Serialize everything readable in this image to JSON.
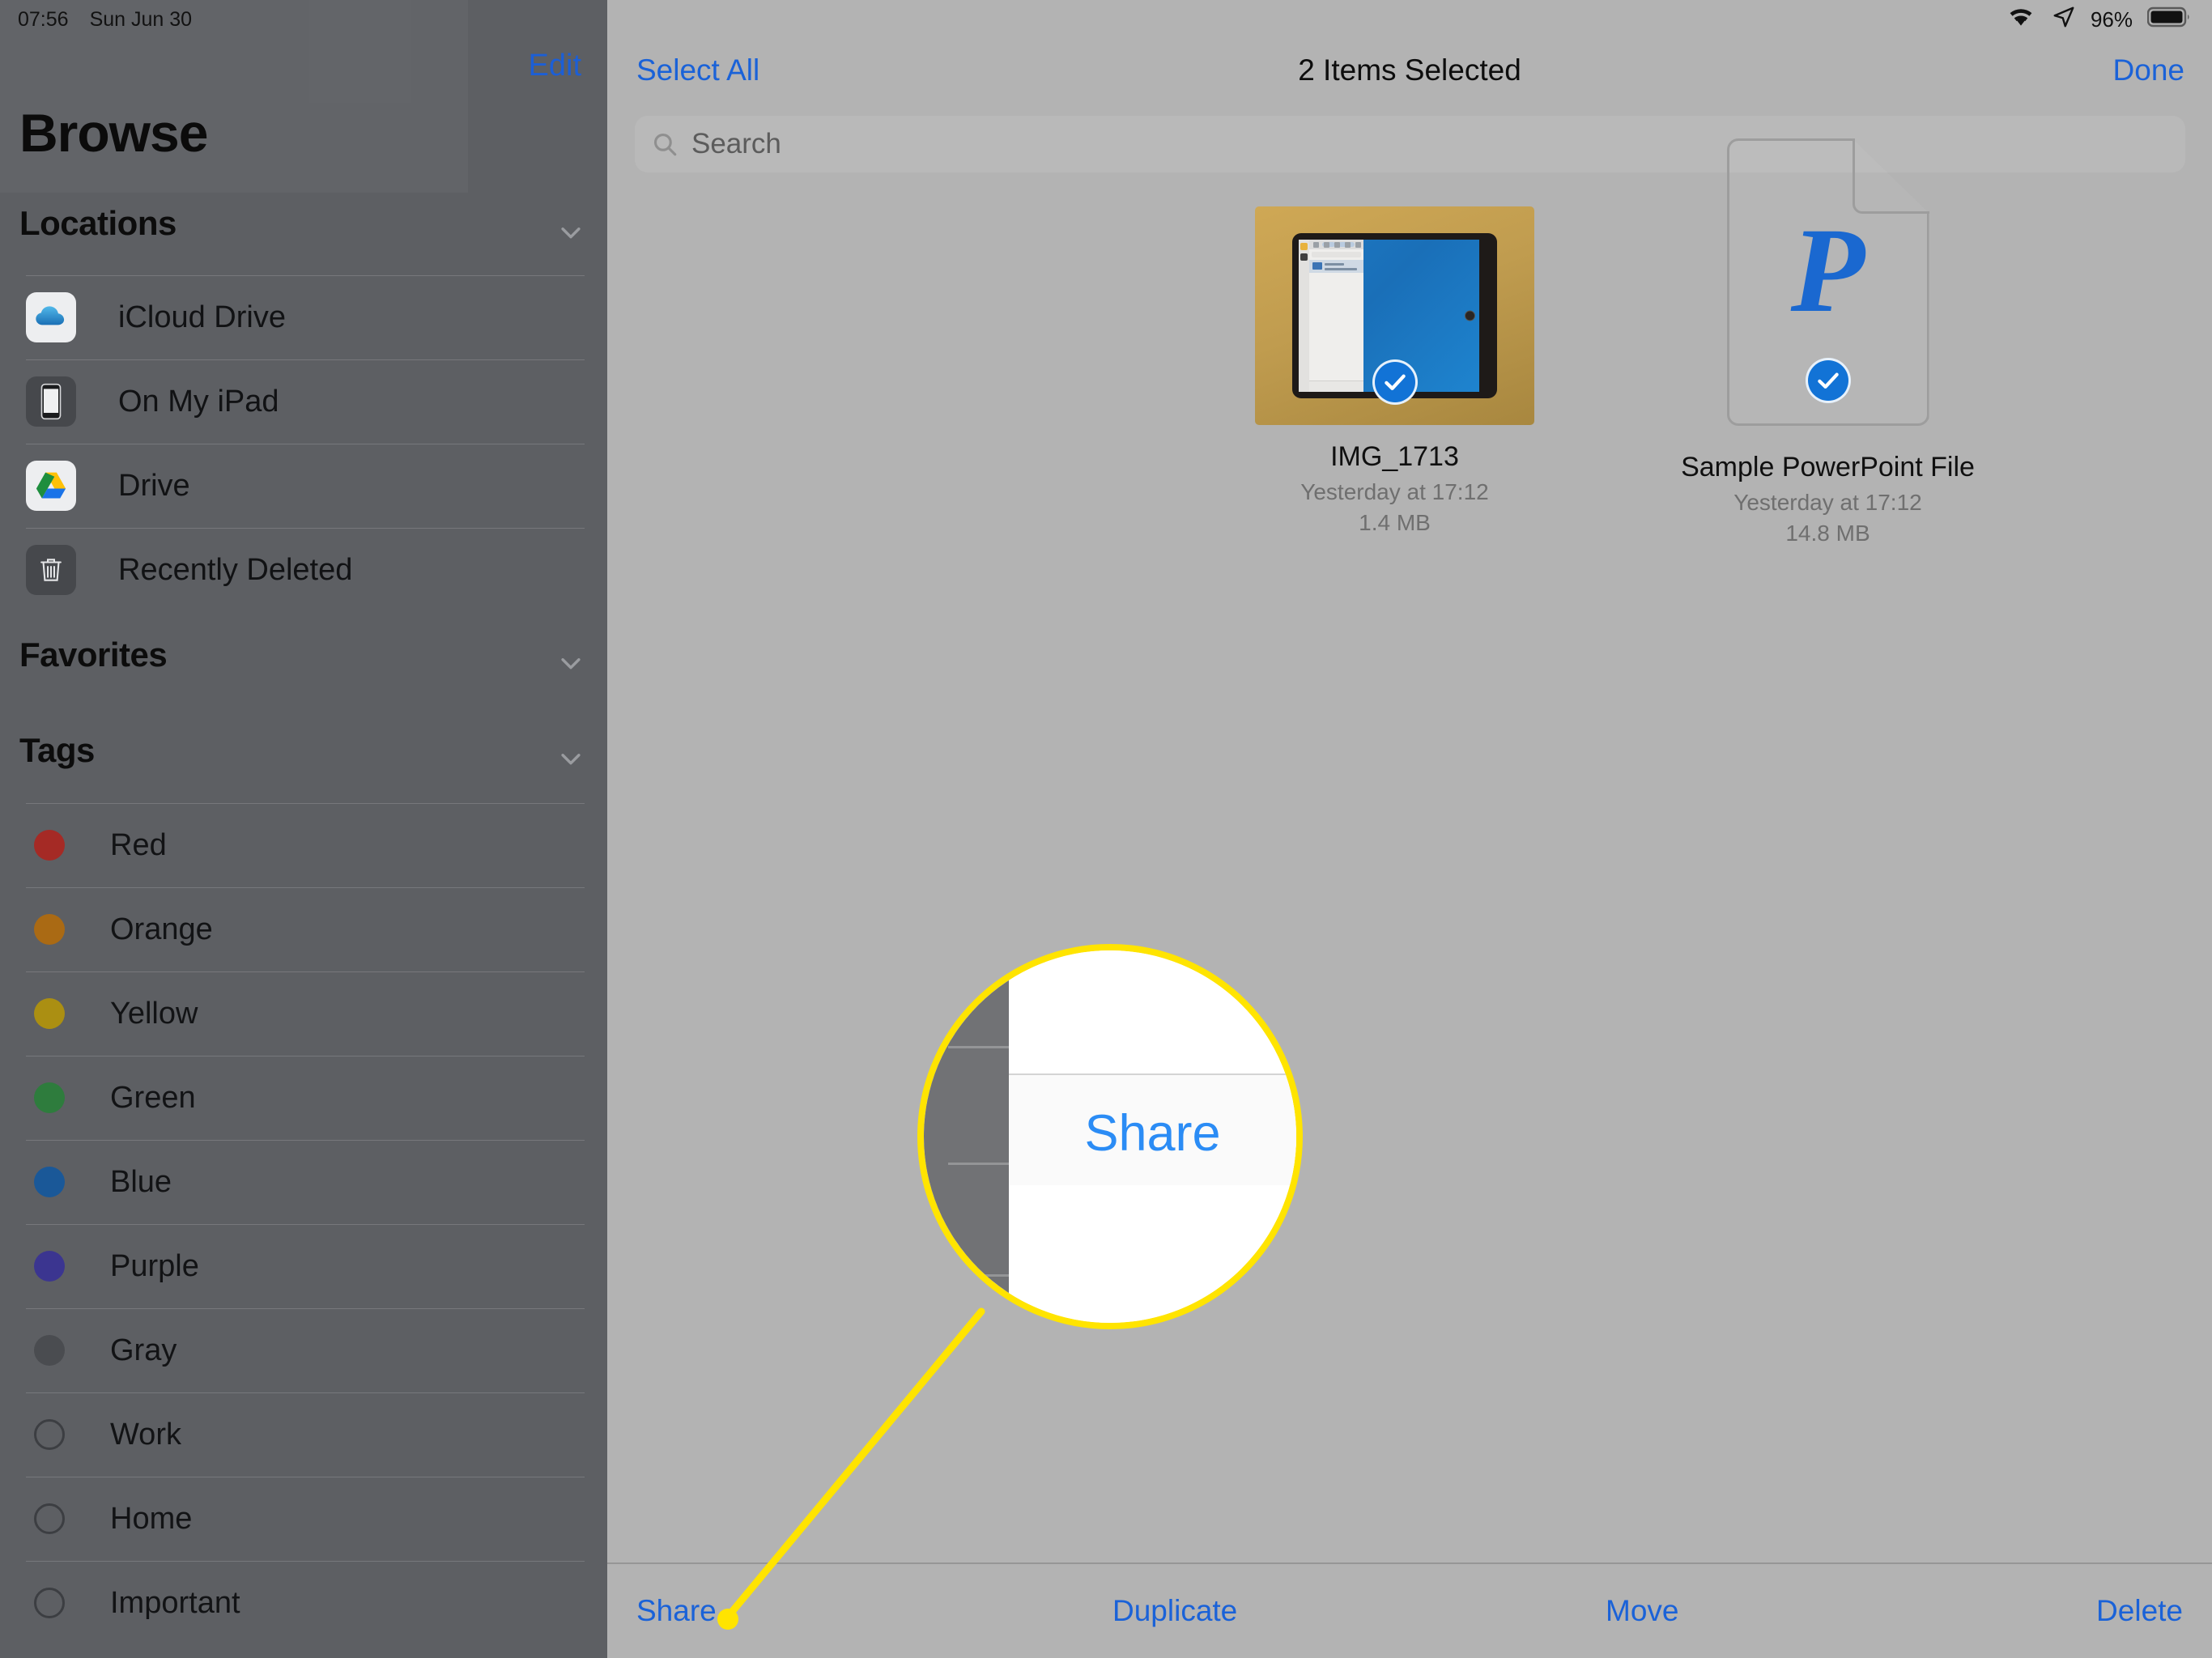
{
  "status_bar": {
    "time": "07:56",
    "date": "Sun Jun 30",
    "wifi_icon": "wifi-icon",
    "location_icon": "location-arrow-icon",
    "battery_percent": "96%",
    "battery_icon": "battery-icon"
  },
  "sidebar": {
    "edit_label": "Edit",
    "title": "Browse",
    "sections": [
      {
        "header": "Locations",
        "chevron_icon": "chevron-down-icon"
      },
      {
        "header": "Favorites",
        "chevron_icon": "chevron-down-icon"
      },
      {
        "header": "Tags",
        "chevron_icon": "chevron-down-icon"
      }
    ],
    "locations": [
      {
        "label": "iCloud Drive",
        "icon": "icloud-drive-icon"
      },
      {
        "label": "On My iPad",
        "icon": "ipad-device-icon"
      },
      {
        "label": "Drive",
        "icon": "google-drive-icon"
      },
      {
        "label": "Recently Deleted",
        "icon": "trash-icon"
      }
    ],
    "tags": [
      {
        "label": "Red",
        "color": "#a52a25",
        "filled": true
      },
      {
        "label": "Orange",
        "color": "#aa6a14",
        "filled": true
      },
      {
        "label": "Yellow",
        "color": "#ab8f12",
        "filled": true
      },
      {
        "label": "Green",
        "color": "#2e7c3d",
        "filled": true
      },
      {
        "label": "Blue",
        "color": "#1a5898",
        "filled": true
      },
      {
        "label": "Purple",
        "color": "#3b3590",
        "filled": true
      },
      {
        "label": "Gray",
        "color": "#4a4c50",
        "filled": true
      },
      {
        "label": "Work",
        "color": "#3c3e42",
        "filled": false
      },
      {
        "label": "Home",
        "color": "#3c3e42",
        "filled": false
      },
      {
        "label": "Important",
        "color": "#3c3e42",
        "filled": false
      }
    ]
  },
  "navbar": {
    "select_all_label": "Select All",
    "title": "2 Items Selected",
    "done_label": "Done"
  },
  "search": {
    "placeholder": "Search",
    "value": "",
    "icon": "search-icon"
  },
  "files": [
    {
      "name": "IMG_1713",
      "date": "Yesterday at 17:12",
      "size": "1.4 MB",
      "type": "photo",
      "selected": true,
      "check_icon": "checkmark-circle-icon"
    },
    {
      "name": "Sample PowerPoint File",
      "date": "Yesterday at 17:12",
      "size": "14.8 MB",
      "type": "powerpoint-document",
      "glyph": "P",
      "selected": true,
      "check_icon": "checkmark-circle-icon"
    }
  ],
  "toolbar": {
    "share_label": "Share",
    "duplicate_label": "Duplicate",
    "move_label": "Move",
    "delete_label": "Delete"
  },
  "callout": {
    "magnified_label": "Share",
    "highlight_color": "#ffe400"
  },
  "colors": {
    "accent_blue": "#1a62d8",
    "magnified_blue": "#2b8cf5",
    "sidebar_bg": "#5d5f63",
    "content_bg": "#b3b3b3",
    "selection_blue": "#1273d6"
  }
}
